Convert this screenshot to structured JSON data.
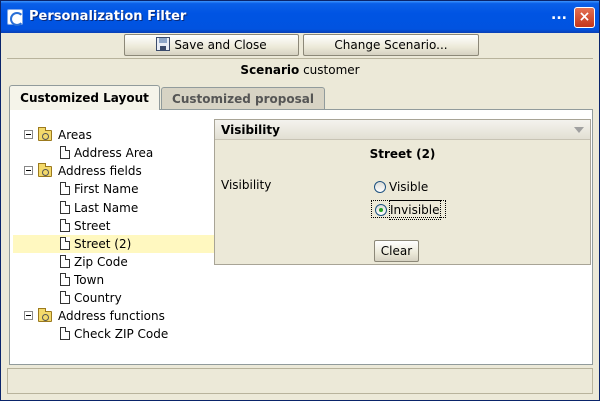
{
  "window": {
    "title": "Personalization Filter",
    "extra_menu": "...",
    "close": "×"
  },
  "toolbar": {
    "save_label": "Save and Close",
    "change_scenario_label": "Change Scenario..."
  },
  "scenario": {
    "label": "Scenario",
    "value": "customer"
  },
  "tabs": [
    {
      "label": "Customized Layout",
      "active": true
    },
    {
      "label": "Customized proposal",
      "active": false
    }
  ],
  "tree": {
    "nodes": [
      {
        "label": "Areas",
        "type": "folder"
      },
      {
        "label": "Address Area",
        "type": "doc"
      },
      {
        "label": "Address fields",
        "type": "folder"
      },
      {
        "label": "First Name",
        "type": "doc"
      },
      {
        "label": "Last Name",
        "type": "doc"
      },
      {
        "label": "Street",
        "type": "doc"
      },
      {
        "label": "Street (2)",
        "type": "doc",
        "selected": true
      },
      {
        "label": "Zip Code",
        "type": "doc"
      },
      {
        "label": "Town",
        "type": "doc"
      },
      {
        "label": "Country",
        "type": "doc"
      },
      {
        "label": "Address functions",
        "type": "folder"
      },
      {
        "label": "Check ZIP Code",
        "type": "doc"
      }
    ]
  },
  "visibility_panel": {
    "header": "Visibility",
    "item_title": "Street (2)",
    "field_label": "Visibility",
    "options": [
      {
        "label": "Visible",
        "checked": false
      },
      {
        "label": "Invisible",
        "checked": true
      }
    ],
    "clear_label": "Clear"
  },
  "colors": {
    "titlebar": "#0054e3",
    "window_bg": "#ece9d8",
    "selected_row": "#fff8c0",
    "radio_check": "#21a121"
  }
}
